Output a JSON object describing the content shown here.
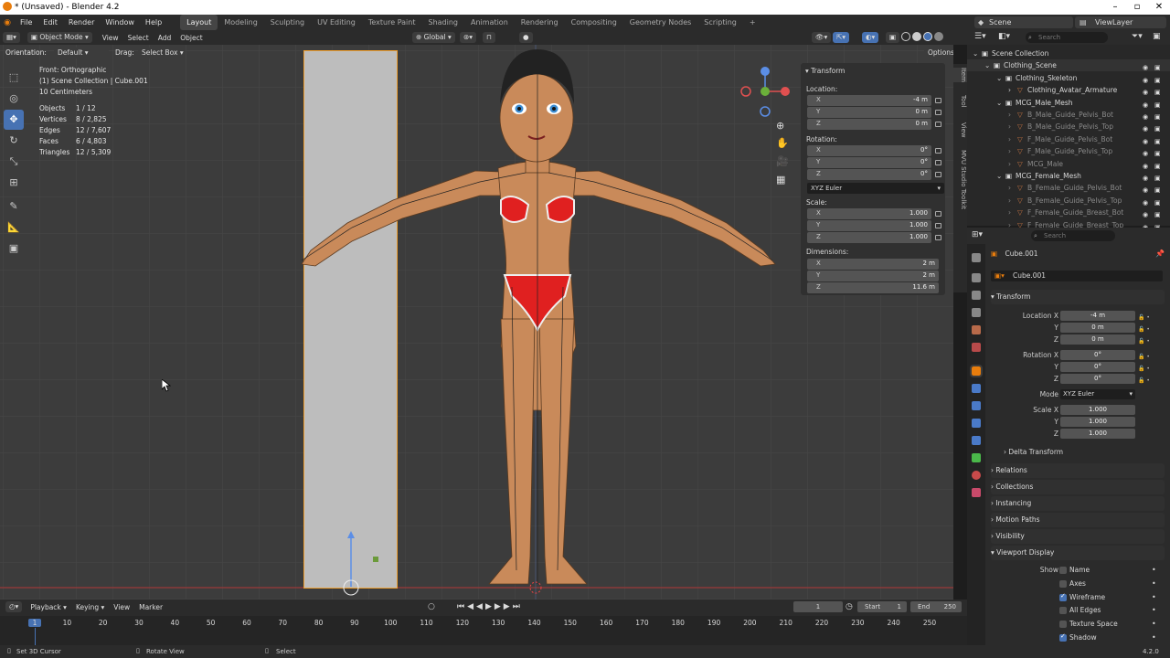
{
  "window": {
    "title": "* (Unsaved) - Blender 4.2"
  },
  "menus": [
    "File",
    "Edit",
    "Render",
    "Window",
    "Help"
  ],
  "workspaces": [
    "Layout",
    "Modeling",
    "Sculpting",
    "UV Editing",
    "Texture Paint",
    "Shading",
    "Animation",
    "Rendering",
    "Compositing",
    "Geometry Nodes",
    "Scripting",
    "+"
  ],
  "scene": {
    "name": "Scene",
    "view_layer": "ViewLayer"
  },
  "viewport_header": {
    "mode": "Object Mode",
    "view": "View",
    "select": "Select",
    "add": "Add",
    "object": "Object",
    "orientation": "Global"
  },
  "tool_header": {
    "orientation_label": "Orientation:",
    "orientation_value": "Default",
    "drag_label": "Drag:",
    "drag_value": "Select Box",
    "options": "Options"
  },
  "overlay": {
    "view_name": "Front: Orthographic",
    "collection": "(1) Scene Collection | Cube.001",
    "scale": "10 Centimeters",
    "stats": [
      {
        "label": "Objects",
        "value": "1 / 12"
      },
      {
        "label": "Vertices",
        "value": "8 / 2,825"
      },
      {
        "label": "Edges",
        "value": "12 / 7,607"
      },
      {
        "label": "Faces",
        "value": "6 / 4,803"
      },
      {
        "label": "Triangles",
        "value": "12 / 5,309"
      }
    ]
  },
  "npanel": {
    "header": "Transform",
    "location_label": "Location:",
    "location": [
      {
        "k": "X",
        "v": "-4 m"
      },
      {
        "k": "Y",
        "v": "0 m"
      },
      {
        "k": "Z",
        "v": "0 m"
      }
    ],
    "rotation_label": "Rotation:",
    "rotation": [
      {
        "k": "X",
        "v": "0°"
      },
      {
        "k": "Y",
        "v": "0°"
      },
      {
        "k": "Z",
        "v": "0°"
      }
    ],
    "rotation_mode": "XYZ Euler",
    "scale_label": "Scale:",
    "scale": [
      {
        "k": "X",
        "v": "1.000"
      },
      {
        "k": "Y",
        "v": "1.000"
      },
      {
        "k": "Z",
        "v": "1.000"
      }
    ],
    "dimensions_label": "Dimensions:",
    "dimensions": [
      {
        "k": "X",
        "v": "2 m"
      },
      {
        "k": "Y",
        "v": "2 m"
      },
      {
        "k": "Z",
        "v": "11.6 m"
      }
    ]
  },
  "side_tabs": [
    "Item",
    "Tool",
    "View",
    "MVU Studio Toolkit"
  ],
  "outliner": {
    "search_placeholder": "Search",
    "rows": [
      {
        "label": "Scene Collection",
        "indent": 0,
        "dim": false
      },
      {
        "label": "Clothing_Scene",
        "indent": 1,
        "dim": false
      },
      {
        "label": "Clothing_Skeleton",
        "indent": 2,
        "dim": false
      },
      {
        "label": "Clothing_Avatar_Armature",
        "indent": 3,
        "dim": false
      },
      {
        "label": "MCG_Male_Mesh",
        "indent": 2,
        "dim": false
      },
      {
        "label": "B_Male_Guide_Pelvis_Bot",
        "indent": 3,
        "dim": true
      },
      {
        "label": "B_Male_Guide_Pelvis_Top",
        "indent": 3,
        "dim": true
      },
      {
        "label": "F_Male_Guide_Pelvis_Bot",
        "indent": 3,
        "dim": true
      },
      {
        "label": "F_Male_Guide_Pelvis_Top",
        "indent": 3,
        "dim": true
      },
      {
        "label": "MCG_Male",
        "indent": 3,
        "dim": true
      },
      {
        "label": "MCG_Female_Mesh",
        "indent": 2,
        "dim": false
      },
      {
        "label": "B_Female_Guide_Pelvis_Bot",
        "indent": 3,
        "dim": true
      },
      {
        "label": "B_Female_Guide_Pelvis_Top",
        "indent": 3,
        "dim": true
      },
      {
        "label": "F_Female_Guide_Breast_Bot",
        "indent": 3,
        "dim": true
      },
      {
        "label": "F_Female_Guide_Breast_Top",
        "indent": 3,
        "dim": true
      }
    ]
  },
  "properties": {
    "search_placeholder": "Search",
    "object_name": "Cube.001",
    "datablock": "Cube.001",
    "transform_header": "Transform",
    "location_labels": [
      "Location X",
      "Y",
      "Z"
    ],
    "location_values": [
      "-4 m",
      "0 m",
      "0 m"
    ],
    "rotation_labels": [
      "Rotation X",
      "Y",
      "Z"
    ],
    "rotation_values": [
      "0°",
      "0°",
      "0°"
    ],
    "mode_label": "Mode",
    "mode_value": "XYZ Euler",
    "scale_labels": [
      "Scale X",
      "Y",
      "Z"
    ],
    "scale_values": [
      "1.000",
      "1.000",
      "1.000"
    ],
    "delta_transform": "Delta Transform",
    "sections": [
      "Relations",
      "Collections",
      "Instancing",
      "Motion Paths",
      "Visibility",
      "Viewport Display"
    ],
    "show_label": "Show",
    "show_options": [
      {
        "label": "Name",
        "checked": false
      },
      {
        "label": "Axes",
        "checked": false
      },
      {
        "label": "Wireframe",
        "checked": true
      },
      {
        "label": "All Edges",
        "checked": false
      },
      {
        "label": "Texture Space",
        "checked": false
      },
      {
        "label": "Shadow",
        "checked": true
      }
    ]
  },
  "timeline": {
    "playback": "Playback",
    "keying": "Keying",
    "view": "View",
    "marker": "Marker",
    "current_frame": "1",
    "start_label": "Start",
    "start": "1",
    "end_label": "End",
    "end": "250",
    "ticks": [
      "1",
      "10",
      "20",
      "30",
      "40",
      "50",
      "60",
      "70",
      "80",
      "90",
      "100",
      "110",
      "120",
      "130",
      "140",
      "150",
      "160",
      "170",
      "180",
      "190",
      "200",
      "210",
      "220",
      "230",
      "240",
      "250"
    ]
  },
  "status": {
    "left": "Set 3D Cursor",
    "middle": "Rotate View",
    "right": "Select",
    "version": "4.2.0"
  },
  "colors": {
    "accent": "#4772b3",
    "selection": "#f0a030",
    "viewport_bg": "#3c3c3c",
    "bikini": "#e02020",
    "skin": "#c98a5a"
  }
}
